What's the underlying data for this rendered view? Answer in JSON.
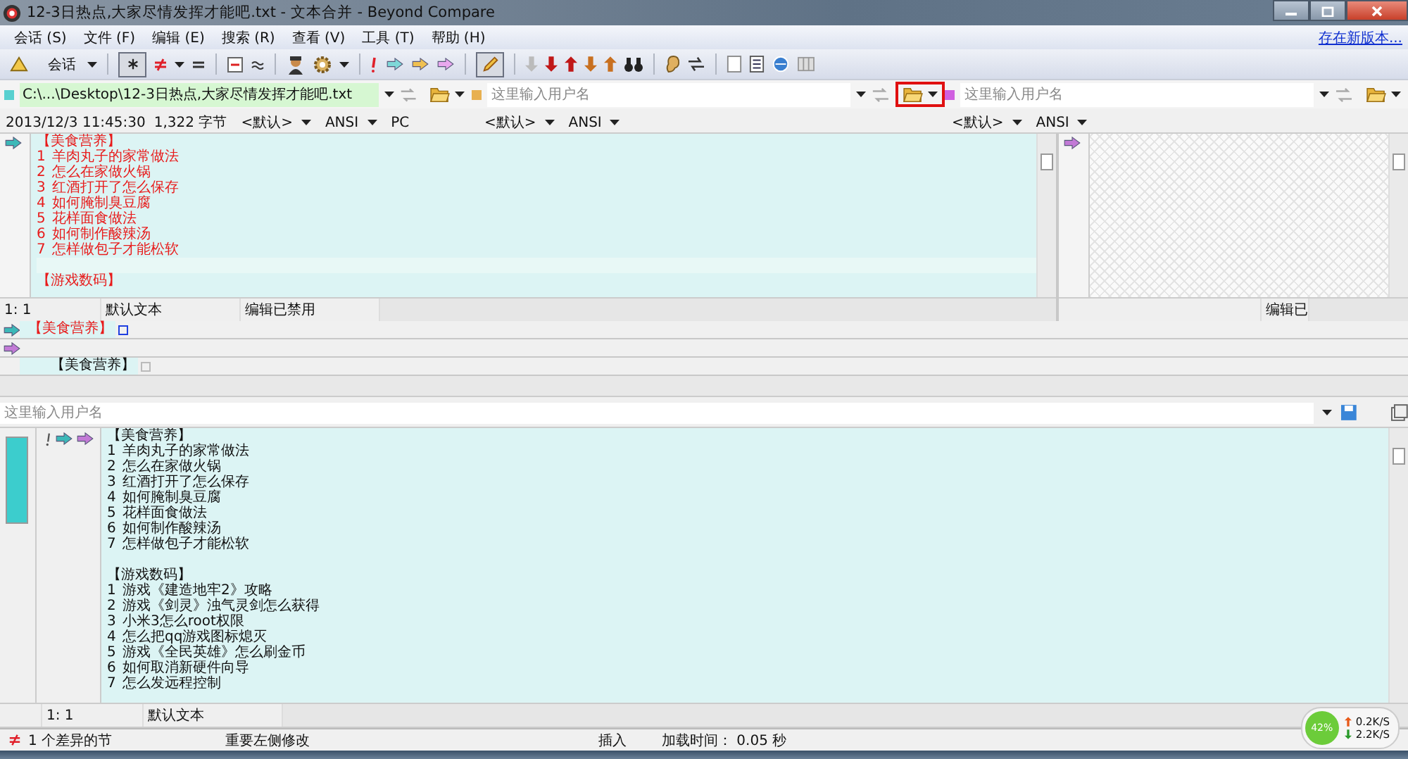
{
  "window": {
    "title": "12-3日热点,大家尽情发挥才能吧.txt - 文本合并 - Beyond Compare"
  },
  "menu": [
    {
      "label": "会话 (S)"
    },
    {
      "label": "文件 (F)"
    },
    {
      "label": "编辑 (E)"
    },
    {
      "label": "搜索 (R)"
    },
    {
      "label": "查看 (V)"
    },
    {
      "label": "工具 (T)"
    },
    {
      "label": "帮助 (H)"
    }
  ],
  "update_link": "存在新版本...",
  "toolbar": {
    "session_label": "会话",
    "filter_pressed": true,
    "edit_pressed": true
  },
  "left": {
    "path": "C:\\...\\Desktop\\12-3日热点,大家尽情发挥才能吧.txt",
    "changed": true,
    "info": {
      "timestamp": "2013/12/3 11:45:30",
      "size": "1,322 字节",
      "format": "<默认>",
      "encoding": "ANSI",
      "line_ending": "PC"
    },
    "lines": [
      {
        "kind": "heading",
        "text": "【美食营养】"
      },
      {
        "kind": "item",
        "number": "1",
        "text": "羊肉丸子的家常做法"
      },
      {
        "kind": "item",
        "number": "2",
        "text": "怎么在家做火锅"
      },
      {
        "kind": "item",
        "number": "3",
        "text": "红酒打开了怎么保存"
      },
      {
        "kind": "item",
        "number": "4",
        "text": "如何腌制臭豆腐"
      },
      {
        "kind": "item",
        "number": "5",
        "text": "花样面食做法"
      },
      {
        "kind": "item",
        "number": "6",
        "text": "如何制作酸辣汤"
      },
      {
        "kind": "item",
        "number": "7",
        "text": "怎样做包子才能松软"
      },
      {
        "kind": "blank"
      },
      {
        "kind": "heading",
        "text": "【游戏数码】"
      }
    ],
    "status": {
      "position": "1: 1",
      "format": "默认文本",
      "edit": "编辑已禁用"
    }
  },
  "middle": {
    "placeholder": "这里输入用户名",
    "open_highlighted": true,
    "info": {
      "format": "<默认>",
      "encoding": "ANSI"
    }
  },
  "right": {
    "placeholder": "这里输入用户名",
    "info": {
      "format": "<默认>",
      "encoding": "ANSI"
    },
    "status": {
      "edit": "编辑已"
    }
  },
  "detail_lines": [
    {
      "kind": "left",
      "text": "【美食营养】"
    },
    {
      "kind": "right"
    },
    {
      "kind": "output",
      "text": "【美食营养】"
    }
  ],
  "output": {
    "placeholder": "这里输入用户名",
    "lines": [
      {
        "kind": "heading",
        "text": "【美食营养】"
      },
      {
        "kind": "item",
        "number": "1",
        "text": "羊肉丸子的家常做法"
      },
      {
        "kind": "item",
        "number": "2",
        "text": "怎么在家做火锅"
      },
      {
        "kind": "item",
        "number": "3",
        "text": "红酒打开了怎么保存"
      },
      {
        "kind": "item",
        "number": "4",
        "text": "如何腌制臭豆腐"
      },
      {
        "kind": "item",
        "number": "5",
        "text": "花样面食做法"
      },
      {
        "kind": "item",
        "number": "6",
        "text": "如何制作酸辣汤"
      },
      {
        "kind": "item",
        "number": "7",
        "text": "怎样做包子才能松软"
      },
      {
        "kind": "blank"
      },
      {
        "kind": "heading",
        "text": "【游戏数码】"
      },
      {
        "kind": "item",
        "number": "1",
        "text": "游戏《建造地牢2》攻略"
      },
      {
        "kind": "item",
        "number": "2",
        "text": "游戏《剑灵》浊气灵剑怎么获得"
      },
      {
        "kind": "item",
        "number": "3",
        "text": "小米3怎么root权限"
      },
      {
        "kind": "item",
        "number": "4",
        "text": "怎么把qq游戏图标熄灭"
      },
      {
        "kind": "item",
        "number": "5",
        "text": "游戏《全民英雄》怎么刷金币"
      },
      {
        "kind": "item",
        "number": "6",
        "text": "如何取消新硬件向导"
      },
      {
        "kind": "item",
        "number": "7",
        "text": "怎么发远程控制"
      }
    ],
    "status": {
      "position": "1: 1",
      "format": "默认文本"
    }
  },
  "status_bar": {
    "differences": "1 个差异的节",
    "note": "重要左侧修改",
    "mode": "插入",
    "load_time": "加载时间： 0.05 秒"
  },
  "network": {
    "cpu": "42%",
    "upload": "0.2K/S",
    "download": "2.2K/S"
  }
}
